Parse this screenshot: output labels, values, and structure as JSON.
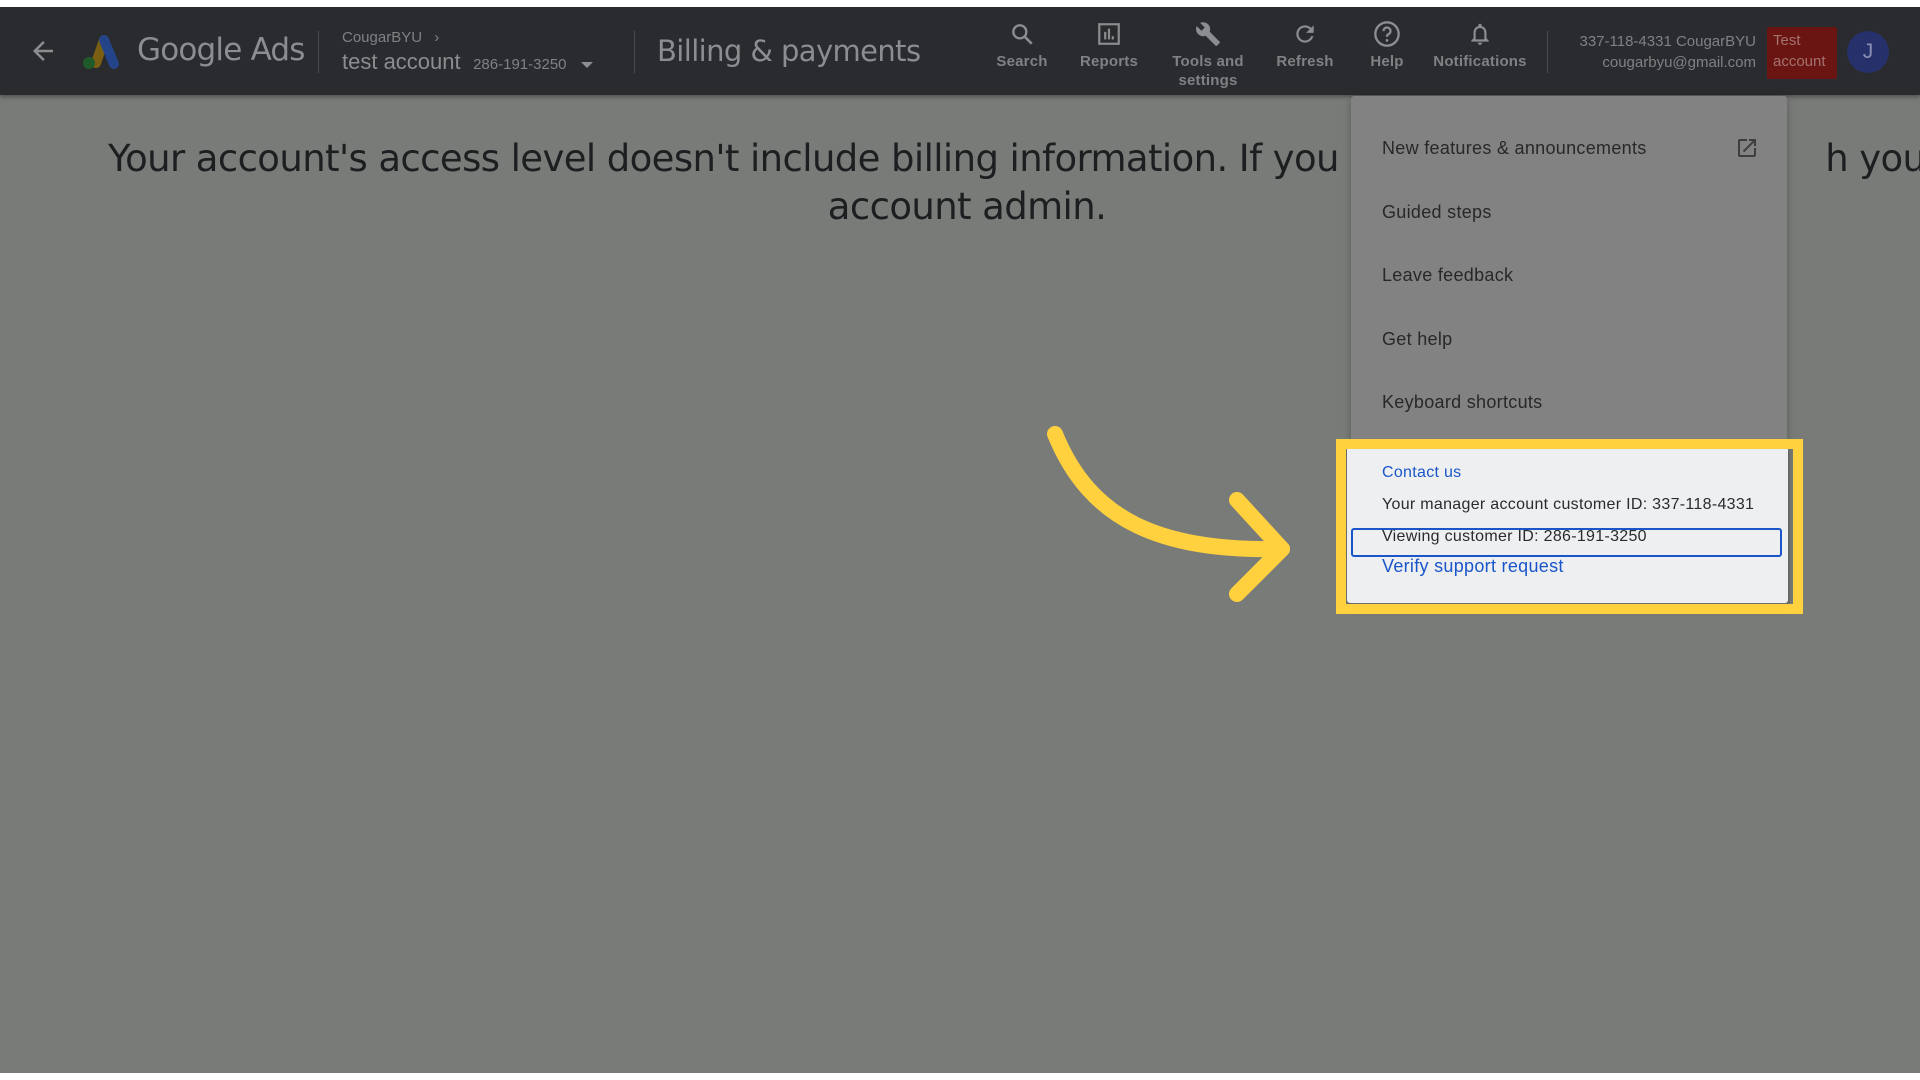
{
  "header": {
    "back_label": "Back",
    "product_name": "Google Ads",
    "breadcrumb_parent": "CougarBYU",
    "account_name": "test account",
    "account_id": "286-191-3250",
    "page_title": "Billing & payments",
    "nav": [
      {
        "label": "Search",
        "icon": "search-icon"
      },
      {
        "label": "Reports",
        "icon": "reports-icon"
      },
      {
        "label": "Tools and settings",
        "icon": "wrench-icon"
      },
      {
        "label": "Refresh",
        "icon": "refresh-icon"
      },
      {
        "label": "Help",
        "icon": "help-icon"
      },
      {
        "label": "Notifications",
        "icon": "bell-icon"
      }
    ],
    "user_account_line": "337-118-4331 CougarBYU",
    "user_email": "cougarbyu@gmail.com",
    "test_badge_line1": "Test",
    "test_badge_line2": "account",
    "avatar_initial": "J"
  },
  "main": {
    "message_line1_left": "Your account's access level doesn't include billing information. If you need a",
    "message_line1_right": "h your",
    "message_line2": "account admin."
  },
  "help_menu": {
    "items": [
      {
        "label": "New features & announcements",
        "icon": "open-in-new-icon"
      },
      {
        "label": "Guided steps"
      },
      {
        "label": "Leave feedback"
      },
      {
        "label": "Get help"
      },
      {
        "label": "Keyboard shortcuts"
      }
    ],
    "contact_us": "Contact us",
    "manager_id_text": "Your manager account customer ID: 337-118-4331",
    "viewing_id_text": "Viewing customer ID: 286-191-3250",
    "verify_link": "Verify support request"
  },
  "colors": {
    "header_bg": "#2a2b2e",
    "overlay_gray": "#797b79",
    "highlight_yellow": "#ffd13f",
    "link_blue": "#1a56c9",
    "test_badge_red": "#6b1512",
    "avatar_blue": "#26316b"
  }
}
